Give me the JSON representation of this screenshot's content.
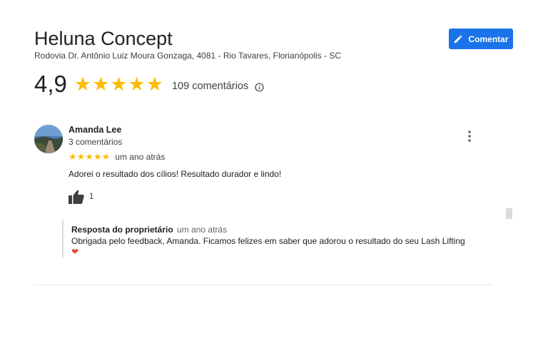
{
  "business": {
    "name": "Heluna Concept",
    "address": "Rodovia Dr. Antônio Luiz Moura Gonzaga, 4081 - Rio Tavares, Florianópolis - SC"
  },
  "header": {
    "comment_button_label": "Comentar"
  },
  "rating": {
    "value": "4,9",
    "stars": 5,
    "review_count": "109 comentários"
  },
  "review": {
    "reviewer_name": "Amanda Lee",
    "reviewer_meta": "3 comentários",
    "stars": 5,
    "date": "um ano atrás",
    "text": "Adorei o resultado dos cílios! Resultado durador e lindo!",
    "likes": "1"
  },
  "owner_reply": {
    "label": "Resposta do proprietário",
    "date": "um ano atrás",
    "text": "Obrigada pelo feedback, Amanda. Ficamos felizes em saber que adorou o resultado do seu Lash Lifting",
    "heart": "❤"
  },
  "colors": {
    "accent": "#1a73e8",
    "star": "#fbbc04",
    "heart": "#ea4335"
  },
  "icons": [
    "pencil-icon",
    "star-icon",
    "info-icon",
    "thumbs-up-icon",
    "more-vert-icon",
    "heart-icon"
  ]
}
